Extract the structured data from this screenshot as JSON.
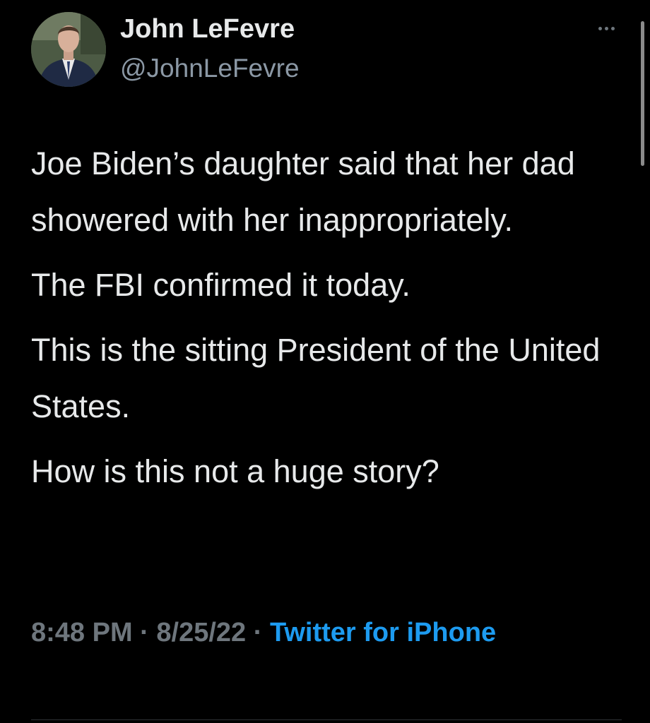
{
  "tweet": {
    "author": {
      "display_name": "John LeFevre",
      "handle": "@JohnLeFevre",
      "avatar_icon": "profile-photo"
    },
    "more_icon": "ellipsis-icon",
    "paragraphs": [
      "Joe Biden’s daughter said that her dad showered with her inappropriately.",
      "The FBI confirmed it today.",
      "This is the sitting President of the United States.",
      "How is this not a huge story?"
    ],
    "meta": {
      "time": "8:48 PM",
      "separator": " · ",
      "date": "8/25/22",
      "source": "Twitter for iPhone"
    }
  },
  "colors": {
    "background": "#000000",
    "text": "#e7e9ea",
    "secondary_text": "#6e767d",
    "link": "#1d9bf0"
  }
}
